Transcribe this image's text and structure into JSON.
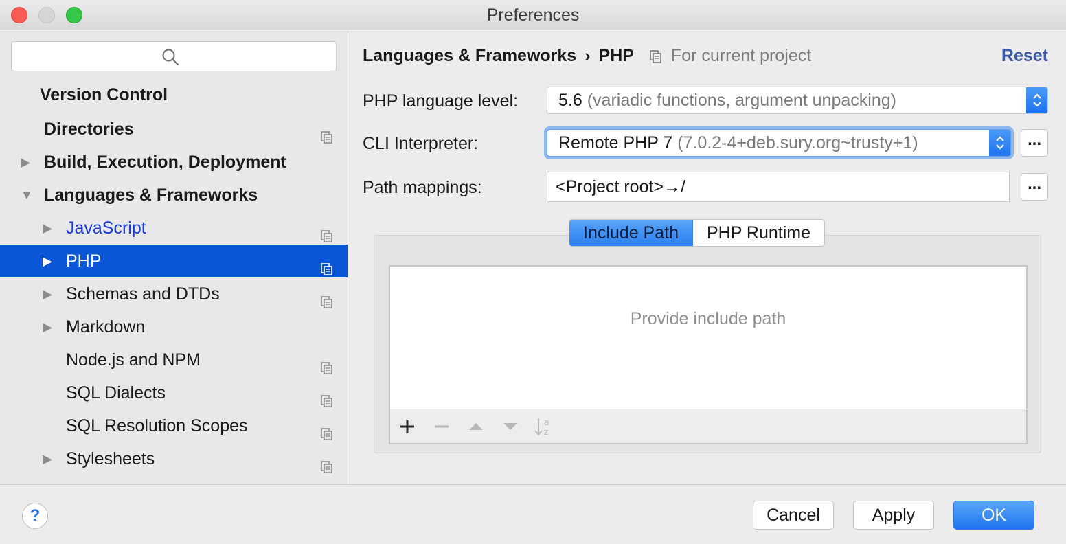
{
  "window": {
    "title": "Preferences"
  },
  "sidebar": {
    "search_placeholder": "",
    "items": [
      {
        "label": "Version Control",
        "arrow": "",
        "copy": false,
        "bold": true
      },
      {
        "label": "Directories",
        "arrow": "",
        "copy": true,
        "bold": true
      },
      {
        "label": "Build, Execution, Deployment",
        "arrow": "▶",
        "copy": false,
        "bold": true
      },
      {
        "label": "Languages & Frameworks",
        "arrow": "▼",
        "copy": false,
        "bold": true
      },
      {
        "label": "JavaScript",
        "arrow": "▶",
        "copy": true,
        "link": true
      },
      {
        "label": "PHP",
        "arrow": "▶",
        "copy": true,
        "selected": true
      },
      {
        "label": "Schemas and DTDs",
        "arrow": "▶",
        "copy": true
      },
      {
        "label": "Markdown",
        "arrow": "▶",
        "copy": false
      },
      {
        "label": "Node.js and NPM",
        "arrow": "",
        "copy": true
      },
      {
        "label": "SQL Dialects",
        "arrow": "",
        "copy": true
      },
      {
        "label": "SQL Resolution Scopes",
        "arrow": "",
        "copy": true
      },
      {
        "label": "Stylesheets",
        "arrow": "▶",
        "copy": true
      }
    ]
  },
  "header": {
    "crumb_parent": "Languages & Frameworks",
    "crumb_sep": "›",
    "crumb_current": "PHP",
    "scope": "For current project",
    "reset": "Reset"
  },
  "form": {
    "language_level_label": "PHP language level:",
    "language_level_value": "5.6",
    "language_level_desc": "(variadic functions, argument unpacking)",
    "cli_label": "CLI Interpreter:",
    "cli_value": "Remote PHP 7",
    "cli_desc": "(7.0.2-4+deb.sury.org~trusty+1)",
    "cli_more": "...",
    "path_label": "Path mappings:",
    "path_value": "<Project root>→/",
    "path_more": "..."
  },
  "tabs": {
    "include_path": "Include Path",
    "php_runtime": "PHP Runtime"
  },
  "include_list": {
    "empty_text": "Provide include path",
    "toolbar_icons": [
      "add-icon",
      "remove-icon",
      "move-up-icon",
      "move-down-icon",
      "sort-az-icon"
    ]
  },
  "footer": {
    "help": "?",
    "cancel": "Cancel",
    "apply": "Apply",
    "ok": "OK"
  },
  "colors": {
    "selection": "#0b56d6",
    "accent": "#2a7ff1",
    "link": "#1a3cd6",
    "reset": "#3b5aa5"
  }
}
